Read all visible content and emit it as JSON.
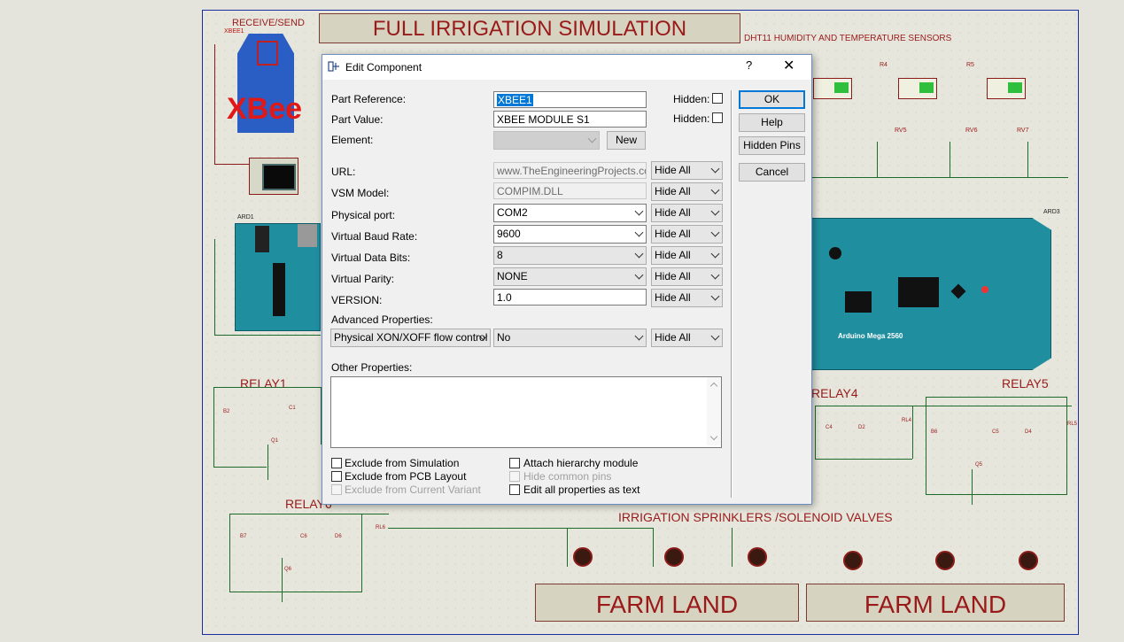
{
  "schematic": {
    "title": "FULL IRRIGATION SIMULATION",
    "receive_send": "RECEIVE/SEND",
    "xbee_ref": "XBEE1",
    "xbee_logo": "XBee",
    "sensors_label": "DHT11  HUMIDITY  AND  TEMPERATURE  SENSORS",
    "ard1": "ARD1",
    "ard3": "ARD3",
    "mega_label": "Arduino Mega 2560",
    "relays": [
      "RELAY1",
      "RELAY4",
      "RELAY5",
      "RELAY6"
    ],
    "sprinklers": "IRRIGATION SPRINKLERS /SOLENOID VALVES",
    "farm_left": "FARM LAND",
    "farm_right": "FARM LAND",
    "rv": [
      "RV5",
      "RV6",
      "RV7"
    ],
    "resistors": [
      "R4",
      "R5"
    ],
    "caps": [
      "C1",
      "C4",
      "C5",
      "C6"
    ],
    "batteries": [
      "B2",
      "B6",
      "B7"
    ],
    "diodes": [
      "D2",
      "D4",
      "D6"
    ],
    "transistors": [
      "Q1",
      "Q5",
      "Q6"
    ],
    "relay_coils": [
      "RL4",
      "RL5",
      "RL6"
    ]
  },
  "dialog": {
    "title": "Edit Component",
    "help_glyph": "?",
    "close_glyph": "✕",
    "fields": {
      "part_reference": {
        "label": "Part Reference:",
        "value": "XBEE1",
        "hidden_label": "Hidden:"
      },
      "part_value": {
        "label": "Part Value:",
        "value": "XBEE MODULE S1",
        "hidden_label": "Hidden:"
      },
      "element": {
        "label": "Element:",
        "value": "",
        "new_button": "New"
      },
      "url": {
        "label": "URL:",
        "value": "www.TheEngineeringProjects.com",
        "visibility": "Hide All"
      },
      "vsm_model": {
        "label": "VSM Model:",
        "value": "COMPIM.DLL",
        "visibility": "Hide All"
      },
      "physical_port": {
        "label": "Physical port:",
        "value": "COM2",
        "visibility": "Hide All"
      },
      "virtual_baud": {
        "label": "Virtual Baud Rate:",
        "value": "9600",
        "visibility": "Hide All"
      },
      "virtual_data_bits": {
        "label": "Virtual Data Bits:",
        "value": "8",
        "visibility": "Hide All"
      },
      "virtual_parity": {
        "label": "Virtual Parity:",
        "value": "NONE",
        "visibility": "Hide All"
      },
      "version": {
        "label": "VERSION:",
        "value": "1.0",
        "visibility": "Hide All"
      }
    },
    "advanced": {
      "label": "Advanced Properties:",
      "property": "Physical XON/XOFF flow control",
      "value": "No",
      "visibility": "Hide All"
    },
    "other_properties": {
      "label": "Other Properties:",
      "value": ""
    },
    "checkboxes": {
      "exclude_simulation": "Exclude from Simulation",
      "exclude_pcb": "Exclude from PCB Layout",
      "exclude_variant": "Exclude from Current Variant",
      "attach_hierarchy": "Attach hierarchy module",
      "hide_common_pins": "Hide common pins",
      "edit_all_text": "Edit all properties as text"
    },
    "buttons": {
      "ok": "OK",
      "help": "Help",
      "hidden_pins": "Hidden Pins",
      "cancel": "Cancel"
    }
  }
}
